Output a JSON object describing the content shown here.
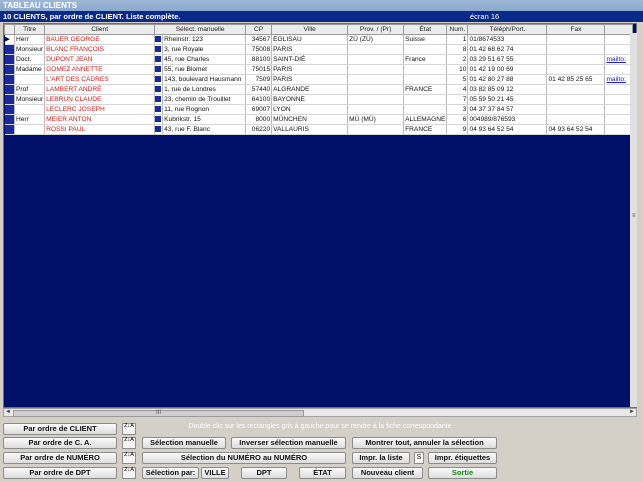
{
  "window": {
    "title": "TABLEAU CLIENTS"
  },
  "info": {
    "summary": "10 CLIENTS, par ordre de CLIENT. Liste complète.",
    "screen": "écran 16"
  },
  "columns": [
    "Titre",
    "Client",
    "Sélect. manuelle",
    "Adresse",
    "CP",
    "Ville",
    "Prov. / (Pr)",
    "État",
    "Num.",
    "Téléph/Port.",
    "Fax",
    ""
  ],
  "rows": [
    {
      "titre": "Herr",
      "client": "BAUER GEORGE",
      "adresse": "Rheinstr. 123",
      "cp": "34567",
      "ville": "EGLISAU",
      "prov": "ZÜ  (ZÜ)",
      "etat": "Suisse",
      "num": "1",
      "tel": "01/8674533",
      "fax": "",
      "mail": ""
    },
    {
      "titre": "Monsieur",
      "client": "BLANC FRANÇOIS",
      "adresse": "3, rue Royale",
      "cp": "75008",
      "ville": "PARIS",
      "prov": "",
      "etat": "",
      "num": "8",
      "tel": "01 42 68 62 74",
      "fax": "",
      "mail": ""
    },
    {
      "titre": "Doct.",
      "client": "DUPONT JEAN",
      "adresse": "45, rue Charles",
      "cp": "88100",
      "ville": "SAINT-DIÉ",
      "prov": "",
      "etat": "France",
      "num": "2",
      "tel": "03 29 51 67 55",
      "fax": "",
      "mail": "mailto:"
    },
    {
      "titre": "Madame",
      "client": "GOMEZ ANNETTE",
      "adresse": "55, rue Blomet",
      "cp": "75015",
      "ville": "PARIS",
      "prov": "",
      "etat": "",
      "num": "10",
      "tel": "01 42 19 00 69",
      "fax": "",
      "mail": ""
    },
    {
      "titre": "",
      "client": "L'ART DES CADRES",
      "adresse": "143, boulevard Hausmann",
      "cp": "7509",
      "ville": "PARIS",
      "prov": "",
      "etat": "",
      "num": "5",
      "tel": "01 42 80 27 88",
      "fax": "01 42 85 25 65",
      "mail": "mailto:"
    },
    {
      "titre": "Prof",
      "client": "LAMBERT ANDRÉ",
      "adresse": "1, rue de Londres",
      "cp": "57440",
      "ville": "ALGRANDE",
      "prov": "",
      "etat": "FRANCE",
      "num": "4",
      "tel": "03 82 85 09 12",
      "fax": "",
      "mail": ""
    },
    {
      "titre": "Monsieur",
      "client": "LEBRUN CLAUDE",
      "adresse": "23, chemin de Trouillet",
      "cp": "64100",
      "ville": "BAYONNE",
      "prov": "",
      "etat": "",
      "num": "7",
      "tel": "05 59 50 21 45",
      "fax": "",
      "mail": ""
    },
    {
      "titre": "",
      "client": "LECLERC JOSEPH",
      "adresse": "11, rue Rognon",
      "cp": "69007",
      "ville": "LYON",
      "prov": "",
      "etat": "",
      "num": "3",
      "tel": "04 37 37 84 57",
      "fax": "",
      "mail": ""
    },
    {
      "titre": "Herr",
      "client": "MEIER ANTON",
      "adresse": "Kubrikstr. 15",
      "cp": "8000",
      "ville": "MÜNCHEN",
      "prov": "MÜ (MÜ)",
      "etat": "ALLEMAGNE",
      "num": "6",
      "tel": "004989/876593",
      "fax": "",
      "mail": ""
    },
    {
      "titre": "",
      "client": "ROSSI PAUL",
      "adresse": "43, rue F. Blanc",
      "cp": "06220",
      "ville": "VALLAURIS",
      "prov": "",
      "etat": "FRANCE",
      "num": "9",
      "tel": "04 93 64 52 54",
      "fax": "04 93 64 52 54",
      "mail": ""
    }
  ],
  "scroll": {
    "thumb_label": "III",
    "left": "◄",
    "right": "►",
    "vmark": "≡"
  },
  "sort_icon": "Z↓A",
  "hint": "Double clic sur les rectangles gris à gauche pour se rendre à la fiche correspondante",
  "buttons": {
    "order_client": "Par ordre de CLIENT",
    "order_ca": "Par ordre de C. A.",
    "order_numero": "Par ordre de NUMÉRO",
    "order_dpt": "Par ordre de DPT",
    "selection_manuelle": "Sélection manuelle",
    "inverser": "Inverser sélection manuelle",
    "montrer_tout": "Montrer tout, annuler la sélection",
    "selection_numero": "Sélection du NUMÉRO au NUMÉRO",
    "impr_liste": "Impr. la liste",
    "s_field": "S",
    "impr_etiquettes": "Impr. étiquettes",
    "selection_par": "Sélection par:",
    "ville": "VILLE",
    "dpt": "DPT",
    "etat": "ÉTAT",
    "nouveau_client": "Nouveau client",
    "sortie": "Sortie"
  }
}
